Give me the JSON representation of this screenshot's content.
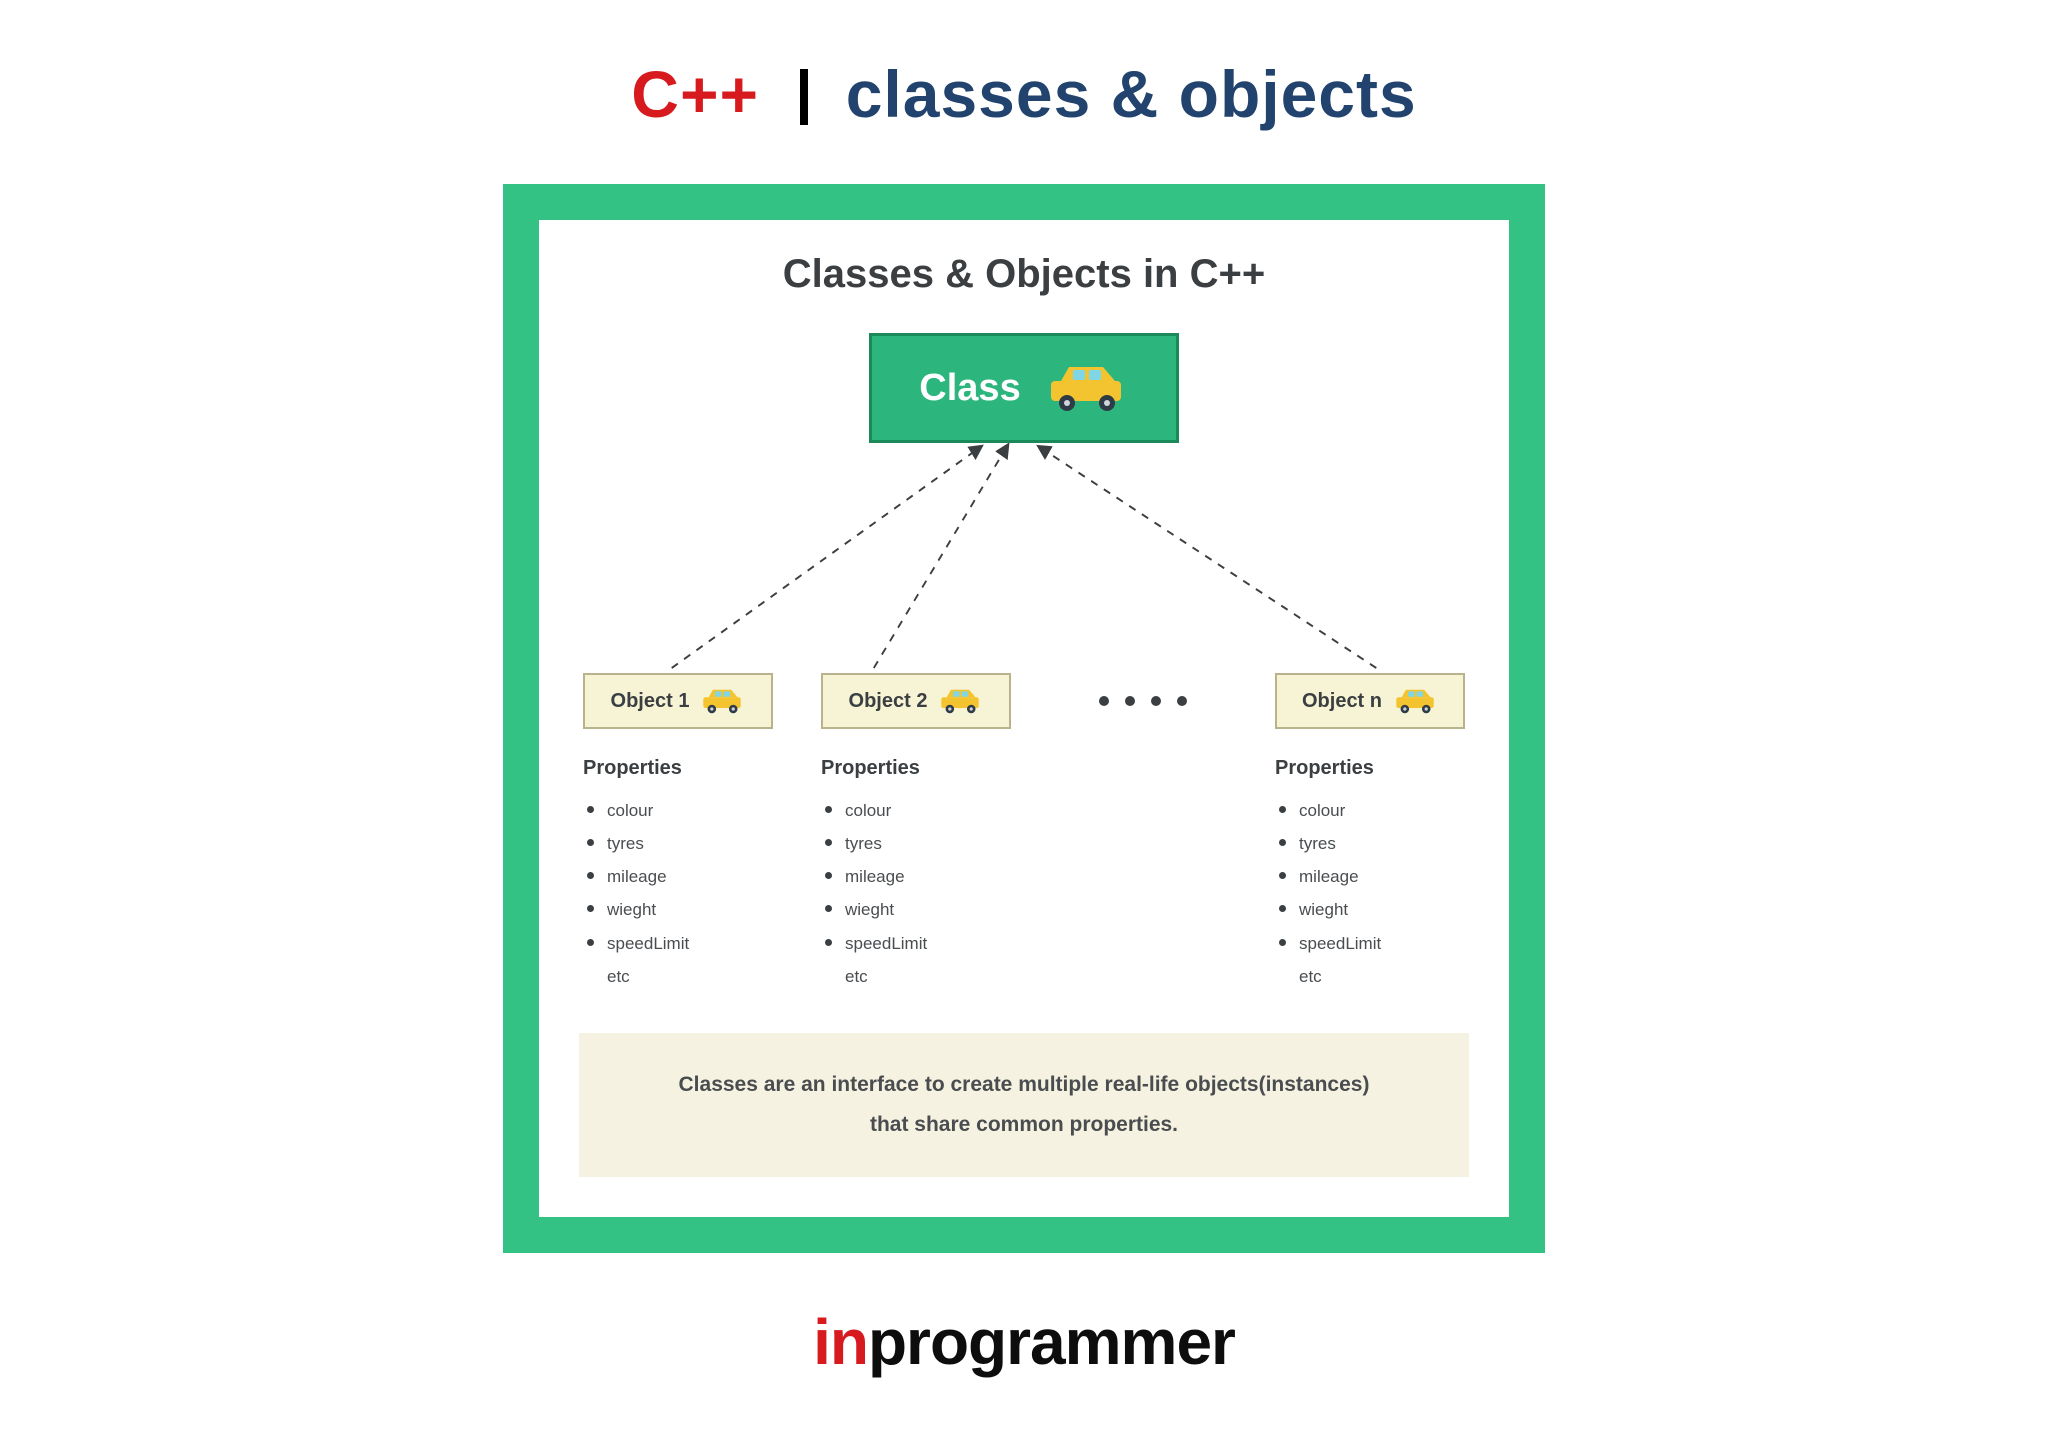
{
  "title": {
    "cpp": "C++",
    "rest": "classes & objects"
  },
  "diagram": {
    "heading": "Classes & Objects in C++",
    "class_label": "Class",
    "objects": [
      {
        "label": "Object 1",
        "props_heading": "Properties",
        "props": [
          "colour",
          "tyres",
          "mileage",
          "wieght",
          "speedLimit",
          "etc"
        ]
      },
      {
        "label": "Object 2",
        "props_heading": "Properties",
        "props": [
          "colour",
          "tyres",
          "mileage",
          "wieght",
          "speedLimit",
          "etc"
        ]
      },
      {
        "label": "Object n",
        "props_heading": "Properties",
        "props": [
          "colour",
          "tyres",
          "mileage",
          "wieght",
          "speedLimit",
          "etc"
        ]
      }
    ],
    "caption_line1": "Classes are an interface to create multiple real-life objects(instances)",
    "caption_line2": "that share common properties."
  },
  "brand": {
    "in": "in",
    "rest": "programmer"
  }
}
